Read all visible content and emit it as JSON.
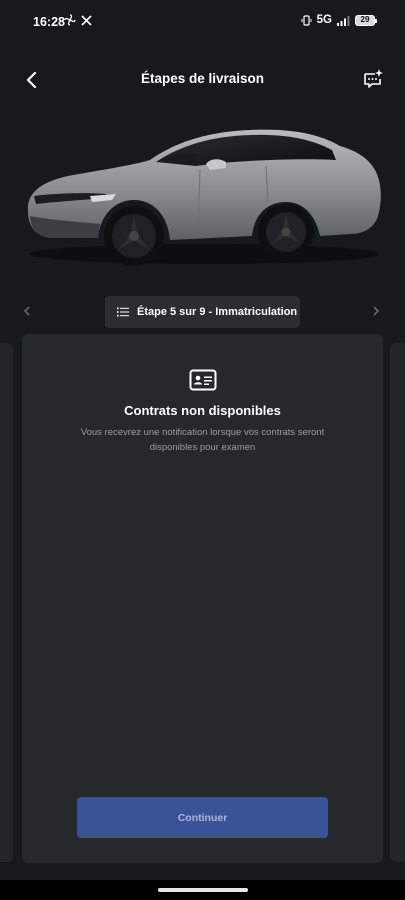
{
  "status_bar": {
    "time": "16:28",
    "network": "5G",
    "battery": "29",
    "left_icons": [
      "fan-icon",
      "x-logo-icon"
    ],
    "right_icons": [
      "vibrate-icon",
      "signal-icon"
    ]
  },
  "header": {
    "title": "Étapes de livraison",
    "back_icon": "chevron-left-icon",
    "chat_icon": "chat-sparkle-icon"
  },
  "car": {
    "color": "#8e9196"
  },
  "stepper": {
    "label": "Étape 5 sur 9 - Immatriculation",
    "list_icon": "list-icon",
    "prev_icon": "chevron-left-icon",
    "next_icon": "chevron-right-icon"
  },
  "card": {
    "icon": "id-card-icon",
    "title": "Contrats non disponibles",
    "description": "Vous recevrez une notification lorsque vos contrats seront disponibles pour examen",
    "button_label": "Continuer"
  },
  "colors": {
    "background": "#171a1c",
    "card": "#26282b",
    "pill": "#2a2d31",
    "button": "#3a5298",
    "muted_text": "#9a9da2"
  }
}
